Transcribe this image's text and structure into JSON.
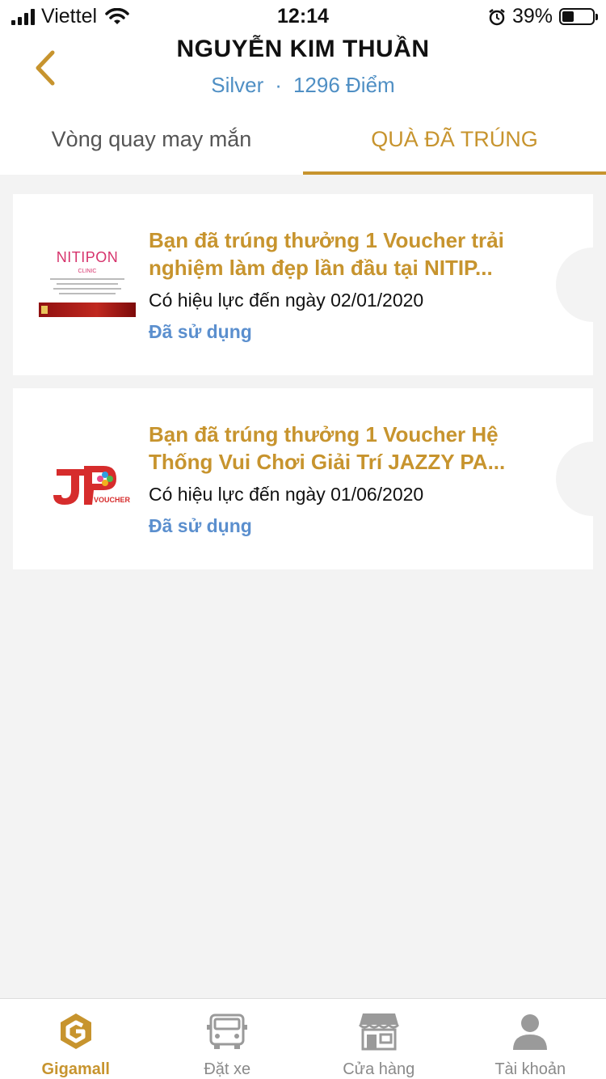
{
  "status_bar": {
    "carrier": "Viettel",
    "time": "12:14",
    "battery_percent": "39%",
    "battery_level": 0.39,
    "icons": [
      "signal-icon",
      "wifi-icon",
      "alarm-icon",
      "battery-icon"
    ]
  },
  "header": {
    "user_name": "NGUYỄN KIM THUẦN",
    "tier": "Silver",
    "separator": "·",
    "points": "1296 Điểm"
  },
  "tabs": [
    {
      "label": "Vòng quay may mắn",
      "active": false
    },
    {
      "label": "QUÀ ĐÃ TRÚNG",
      "active": true
    }
  ],
  "vouchers": [
    {
      "title": "Bạn đã trúng thưởng 1 Voucher trải nghiệm làm đẹp lần đầu tại NITIP...",
      "validity": "Có hiệu lực đến ngày 02/01/2020",
      "status": "Đã sử dụng",
      "thumb": {
        "brand": "NITIPON",
        "sub": "CLINIC"
      }
    },
    {
      "title": "Bạn đã trúng thưởng 1 Voucher Hệ Thống Vui Chơi Giải Trí JAZZY PA...",
      "validity": "Có hiệu lực đến ngày 01/06/2020",
      "status": "Đã sử dụng",
      "thumb": {
        "brand": "JP",
        "sub": "VOUCHER"
      }
    }
  ],
  "bottom_nav": [
    {
      "label": "Gigamall",
      "icon": "gigamall-logo-icon",
      "active": true
    },
    {
      "label": "Đặt xe",
      "icon": "car-icon",
      "active": false
    },
    {
      "label": "Cửa hàng",
      "icon": "store-icon",
      "active": false
    },
    {
      "label": "Tài khoản",
      "icon": "account-icon",
      "active": false
    }
  ],
  "colors": {
    "accent": "#c7942e",
    "link_blue": "#5b8fce",
    "tier_blue": "#4f8fc4",
    "background": "#f3f3f3",
    "inactive": "#8a8a8a"
  }
}
